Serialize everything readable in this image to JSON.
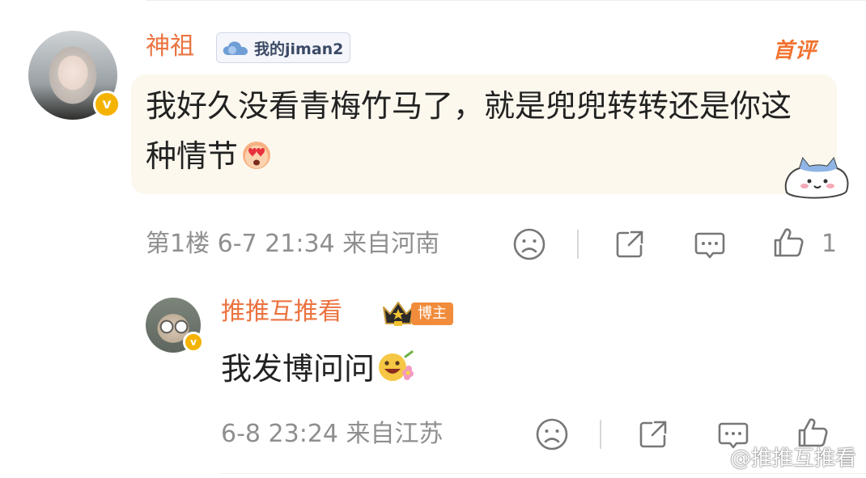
{
  "comments": [
    {
      "username": "神祖",
      "fan_badge": "我的jiman2",
      "top_badge": "首评",
      "text": "我好久没看青梅竹马了，就是兜兜转转还是你这种情节",
      "meta": "第1楼  6-7 21:34  来自河南",
      "likes": "1",
      "emoji": "heart-eyes-emoji"
    },
    {
      "username": "推推互推看",
      "role_tag": "博主",
      "text": "我发博问问",
      "meta": "6-8 23:24  来自江苏",
      "emoji": "flower-smile-emoji"
    }
  ],
  "watermark": "@推推互推看",
  "colors": {
    "username": "#eb7340",
    "meta_text": "#8f8f8f",
    "bubble_bg": "#fcf8ee",
    "verified_badge": "#f5b301",
    "top_badge": "#f2722f"
  },
  "icons": [
    "dislike-icon",
    "share-icon",
    "comment-icon",
    "like-icon",
    "verified-icon",
    "crown-icon",
    "cloud-icon",
    "weibo-logo-icon"
  ]
}
